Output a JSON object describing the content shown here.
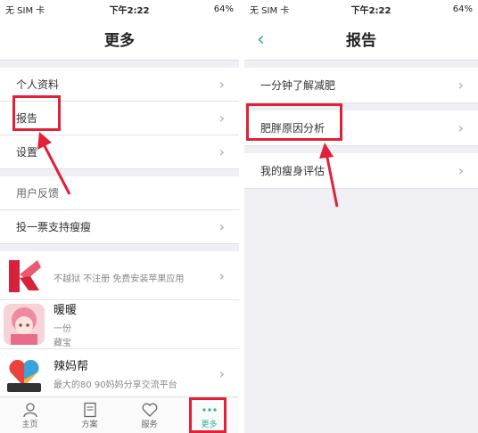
{
  "left": {
    "status": {
      "carrier": "无 SIM 卡",
      "time": "下午2:22",
      "battery": "64%"
    },
    "title": "更多",
    "rows_group1": [
      {
        "label": "个人资料"
      },
      {
        "label": "报告"
      },
      {
        "label": "设置"
      }
    ],
    "rows_group2": [
      {
        "label": "用户反馈"
      },
      {
        "label": "投一票支持瘦瘦"
      }
    ],
    "apps": [
      {
        "title": "",
        "subtitle": "不越狱 不注册 免费安装苹果应用",
        "icon": "red-k-logo-icon"
      },
      {
        "title": "暖暖",
        "subtitle": "一份",
        "subtitle2": "藏宝",
        "icon": "anime-girl-icon"
      },
      {
        "title": "辣妈帮",
        "subtitle": "最大的80 90妈妈分享交流平台",
        "icon": "lamabang-heart-icon"
      }
    ],
    "tabs": [
      {
        "label": "主页",
        "icon": "person-icon"
      },
      {
        "label": "方案",
        "icon": "document-icon"
      },
      {
        "label": "服务",
        "icon": "heart-icon"
      },
      {
        "label": "更多",
        "icon": "dots-icon"
      }
    ],
    "colors": {
      "accent": "#2bb19b",
      "highlight": "#e0213a"
    }
  },
  "right": {
    "status": {
      "carrier": "无 SIM 卡",
      "time": "下午2:22",
      "battery": "64%"
    },
    "title": "报告",
    "rows": [
      {
        "label": "一分钟了解减肥"
      },
      {
        "label": "肥胖原因分析"
      },
      {
        "label": "我的瘦身评估"
      }
    ]
  }
}
